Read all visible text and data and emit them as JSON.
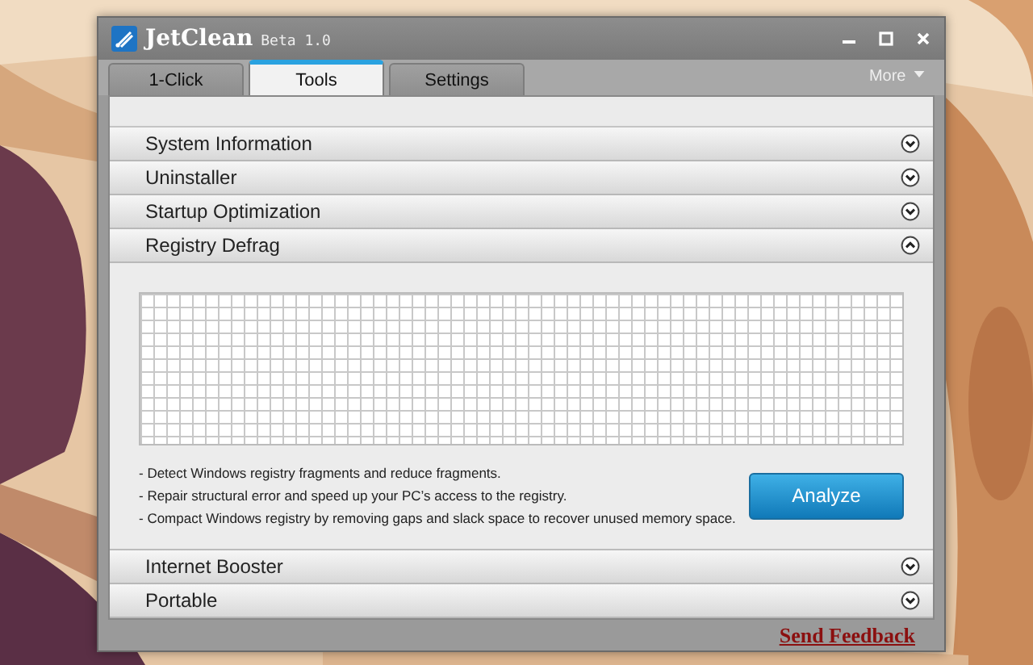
{
  "window": {
    "title": "JetClean",
    "subtitle": "Beta 1.0"
  },
  "tabs": [
    {
      "label": "1-Click",
      "selected": false
    },
    {
      "label": "Tools",
      "selected": true
    },
    {
      "label": "Settings",
      "selected": false
    }
  ],
  "more_menu": "More",
  "sections": [
    {
      "title": "System Information",
      "expanded": false
    },
    {
      "title": "Uninstaller",
      "expanded": false
    },
    {
      "title": "Startup Optimization",
      "expanded": false
    },
    {
      "title": "Registry Defrag",
      "expanded": true,
      "notes": [
        "- Detect Windows registry fragments and reduce fragments.",
        "- Repair structural error and speed up your PC’s access to the registry.",
        "- Compact Windows registry by removing gaps and slack space to recover unused memory space."
      ],
      "button": "Analyze"
    },
    {
      "title": "Internet Booster",
      "expanded": false
    },
    {
      "title": "Portable",
      "expanded": false
    }
  ],
  "feedback_link": "Send Feedback"
}
